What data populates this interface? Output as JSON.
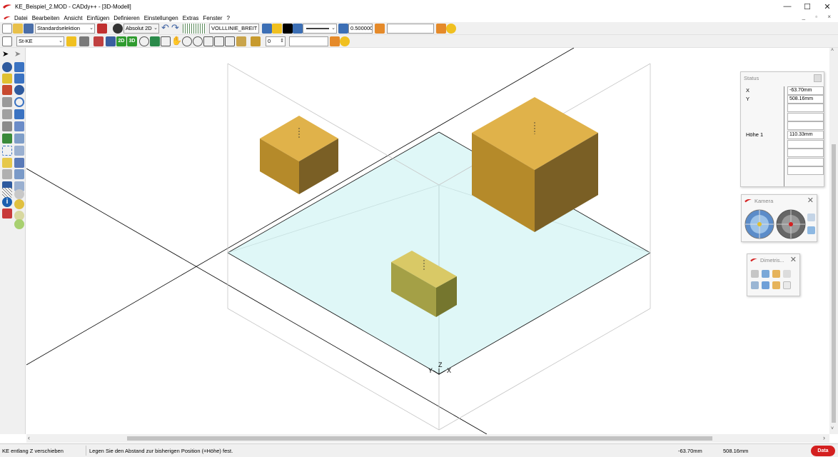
{
  "window": {
    "title": "KE_Beispiel_2.MOD  -  CADdy++ - [3D-Modell]",
    "minimize": "—",
    "maximize": "☐",
    "close": "✕",
    "mdi_controls": "_ ▫ ×"
  },
  "menu": [
    "Datei",
    "Bearbeiten",
    "Ansicht",
    "Einfügen",
    "Definieren",
    "Einstellungen",
    "Extras",
    "Fenster",
    "?"
  ],
  "toolbar1": {
    "selection_mode": "Standardselektion",
    "coordinate_mode": "Absolut 2D",
    "line_type": "VOLLLINIE_BREIT",
    "line_width": "0.500000",
    "text_field": ""
  },
  "toolbar2": {
    "object_type": "St-KE",
    "badge_2d": "2D",
    "badge_3d": "3D",
    "level_value": "0",
    "text_field": ""
  },
  "status_panel": {
    "title": "Status",
    "rows": [
      {
        "label": "X",
        "value": "-63.70mm"
      },
      {
        "label": "Y",
        "value": "508.16mm"
      },
      {
        "label": "",
        "value": ""
      },
      {
        "label": "",
        "value": ""
      },
      {
        "label": "",
        "value": ""
      },
      {
        "label": "Höhe 1",
        "value": "110.33mm"
      },
      {
        "label": "",
        "value": ""
      },
      {
        "label": "",
        "value": ""
      },
      {
        "label": "",
        "value": ""
      },
      {
        "label": "",
        "value": ""
      }
    ]
  },
  "camera_panel": {
    "title": "Kamera"
  },
  "dimetric_panel": {
    "title": "Dimetris..."
  },
  "axes": {
    "y": "Y",
    "z": "Z",
    "x": "X"
  },
  "statusbar": {
    "command": "KE entlang Z verschieben",
    "prompt": "Legen Sie den Abstand zur bisherigen Position (=Höhe) fest.",
    "coord_x": "-63.70mm",
    "coord_y": "508.16mm",
    "brand": "Data"
  },
  "colors": {
    "accent_red": "#d42020",
    "box_top": "#e0b24a",
    "box_left": "#b58a2a",
    "box_right": "#7a5f25",
    "plane": "#dff7f7",
    "small_box_top": "#d9c966",
    "small_box_left": "#a4a046",
    "small_box_right": "#75762e"
  }
}
